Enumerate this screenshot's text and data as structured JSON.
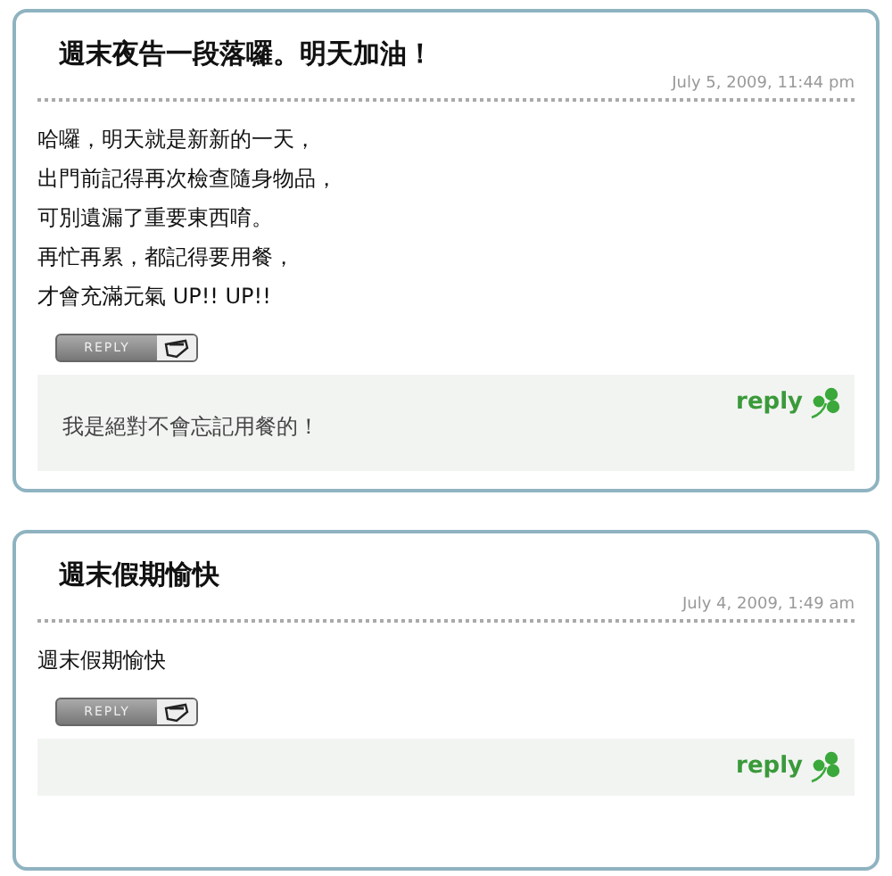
{
  "posts": [
    {
      "title": "週末夜告一段落囉。明天加油！",
      "date": "July 5, 2009, 11:44 pm",
      "body_lines": [
        "哈囉，明天就是新新的一天，",
        "出門前記得再次檢查隨身物品，",
        "可別遺漏了重要東西唷。",
        "再忙再累，都記得要用餐，",
        "才會充滿元氣 UP!! UP!!"
      ],
      "reply_button": "REPLY",
      "comments": [
        "我是絕對不會忘記用餐的！"
      ],
      "reply_link": "reply"
    },
    {
      "title": "週末假期愉快",
      "date": "July 4, 2009, 1:49 am",
      "body_lines": [
        "週末假期愉快"
      ],
      "reply_button": "REPLY",
      "reply_link": "reply"
    }
  ]
}
